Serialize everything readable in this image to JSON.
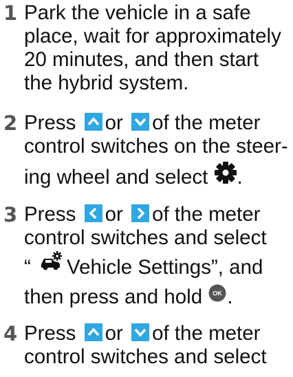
{
  "steps": [
    {
      "number": "1",
      "lines": [
        "Park the vehicle in a safe",
        "place, wait for approximately",
        "20 minutes, and then start",
        "the hybrid system."
      ]
    },
    {
      "number": "2",
      "line1_pre": "Press",
      "line1_mid": "or",
      "line1_post": "of the meter",
      "line2": "control switches on the steer-",
      "line3_pre": "ing wheel and select",
      "line3_post": ".",
      "icons": [
        "arrow-up-button-icon",
        "arrow-down-button-icon",
        "gear-settings-icon"
      ]
    },
    {
      "number": "3",
      "line1_pre": "Press",
      "line1_mid": "or",
      "line1_post": "of the meter",
      "line2": "control switches and select",
      "line3_quote_open": "“",
      "line3_post": "Vehicle Settings”, and",
      "line4_pre": "then press and hold",
      "line4_post": ".",
      "ok_label": "OK",
      "icons": [
        "arrow-left-button-icon",
        "arrow-right-button-icon",
        "vehicle-settings-icon",
        "ok-button-icon"
      ]
    },
    {
      "number": "4",
      "line1_pre": "Press",
      "line1_mid": "or",
      "line1_post": "of the meter",
      "line2": "control switches and select",
      "icons": [
        "arrow-up-button-icon",
        "arrow-down-button-icon"
      ]
    }
  ],
  "colors": {
    "accent_button": "#2fa7e1",
    "step_number": "#555555",
    "text": "#111111"
  }
}
